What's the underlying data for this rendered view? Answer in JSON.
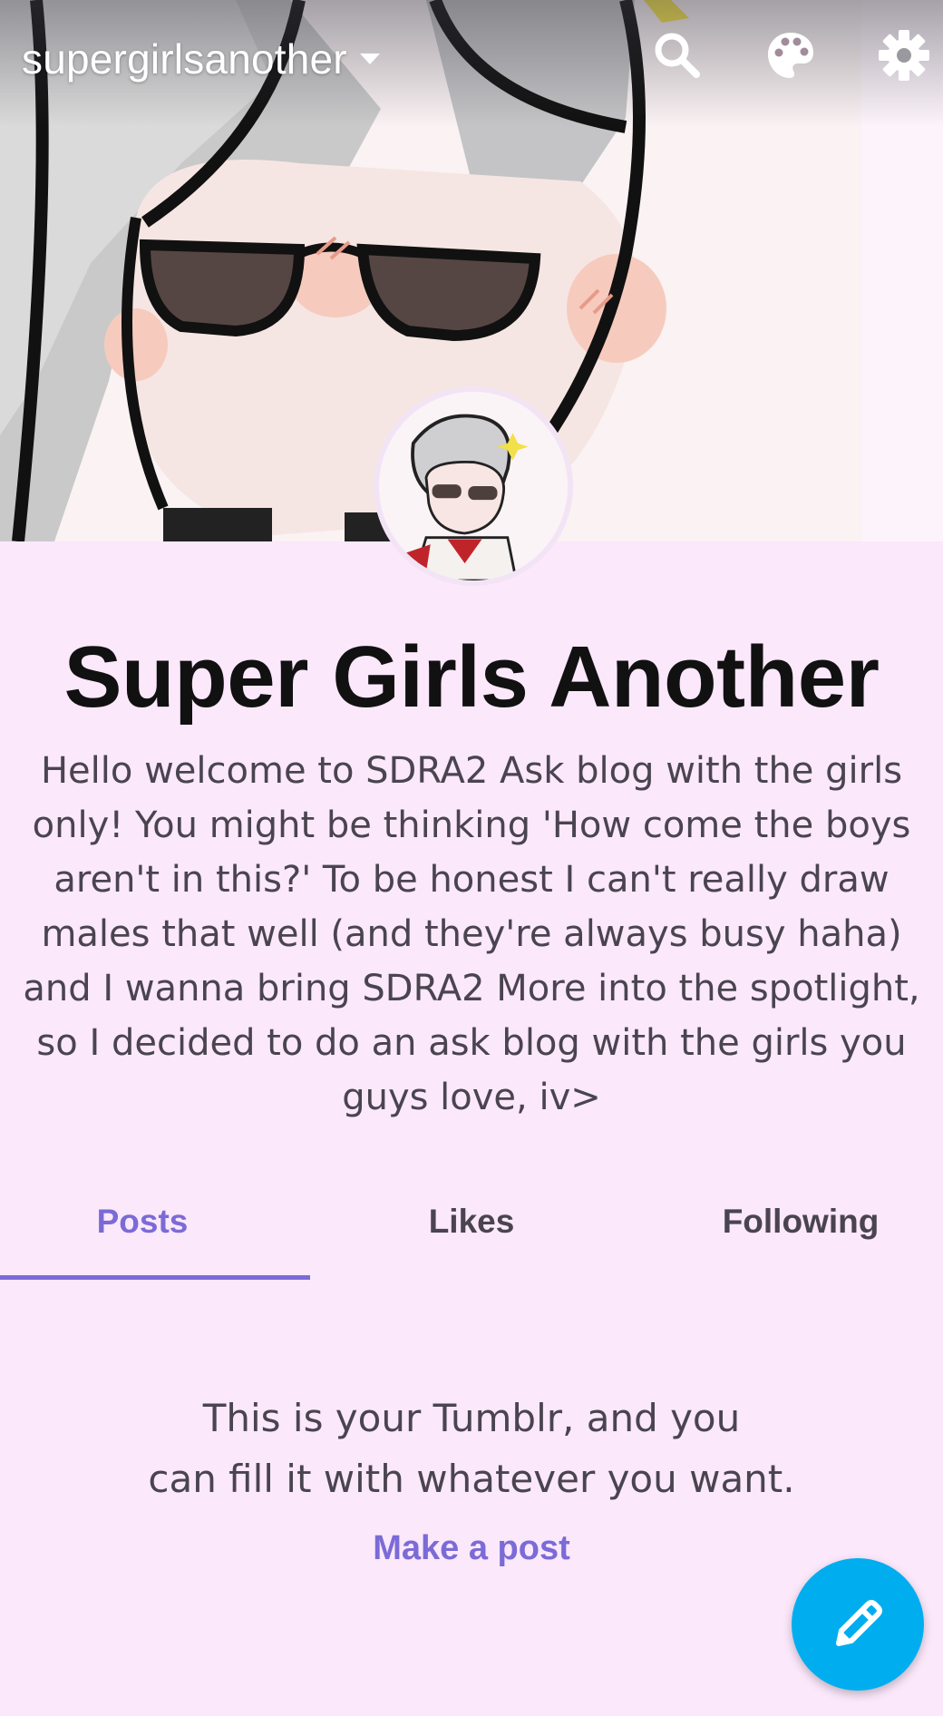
{
  "header": {
    "blog_name": "supergirlsanother"
  },
  "profile": {
    "title": "Super Girls Another",
    "description": "Hello welcome to SDRA2 Ask blog with the girls only! You might be thinking 'How come the boys aren't in this?' To be honest I can't really draw males that well (and they're always busy haha) and I wanna bring SDRA2 More into the spotlight, so I decided to do an ask blog with the girls you guys love, iv>"
  },
  "tabs": [
    {
      "label": "Posts",
      "active": true
    },
    {
      "label": "Likes",
      "active": false
    },
    {
      "label": "Following",
      "active": false
    }
  ],
  "empty_state": {
    "line1": "This is your Tumblr, and you",
    "line2": "can fill it with whatever you want.",
    "action": "Make a post"
  },
  "icons": {
    "search": "search-icon",
    "palette": "palette-icon",
    "settings": "gear-icon",
    "compose": "pencil-icon"
  },
  "colors": {
    "background": "#fbe8fb",
    "accent": "#7b6bd6",
    "fab": "#00aef0",
    "text": "#4a4450"
  }
}
